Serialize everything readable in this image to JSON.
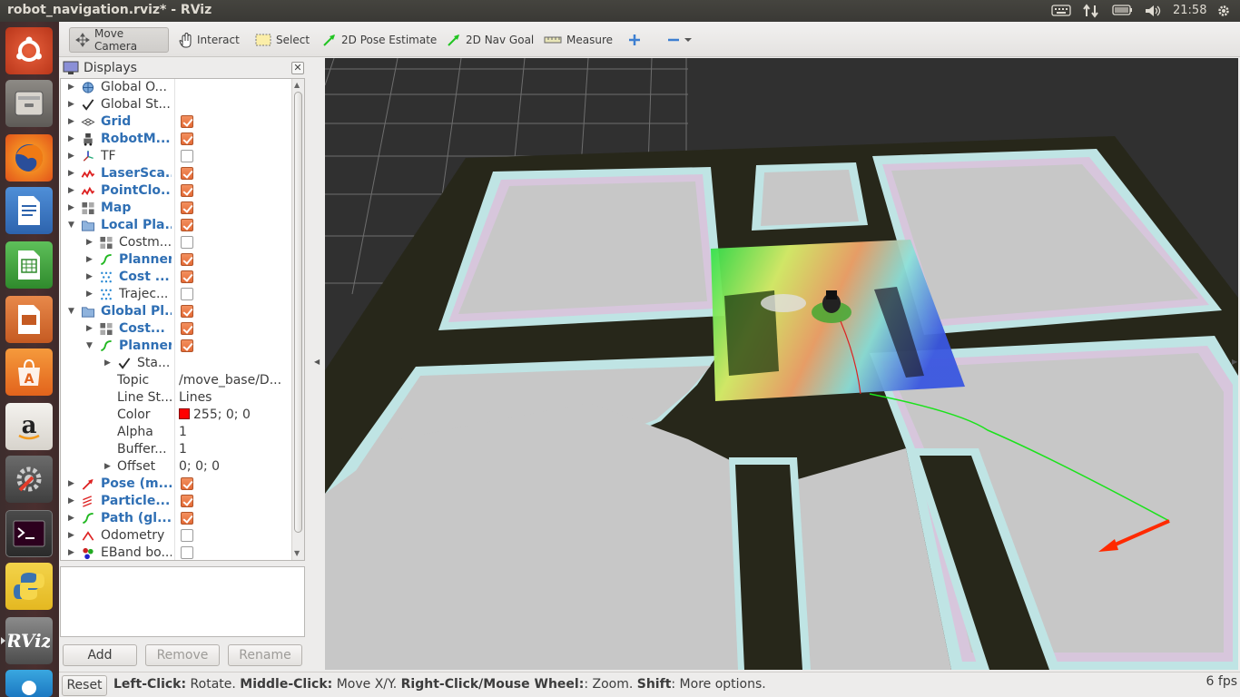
{
  "window": {
    "title": "robot_navigation.rviz* - RViz"
  },
  "tray": {
    "clock": "21:58"
  },
  "toolbar": {
    "move_camera": "Move Camera",
    "interact": "Interact",
    "select": "Select",
    "pose_estimate": "2D Pose Estimate",
    "nav_goal": "2D Nav Goal",
    "measure": "Measure"
  },
  "displays": {
    "title": "Displays",
    "rows": [
      {
        "label": "Global O...",
        "blue": false,
        "checked": null
      },
      {
        "label": "Global St...",
        "blue": false,
        "checked": null
      },
      {
        "label": "Grid",
        "blue": true,
        "checked": true
      },
      {
        "label": "RobotM...",
        "blue": true,
        "checked": true
      },
      {
        "label": "TF",
        "blue": false,
        "checked": false
      },
      {
        "label": "LaserSca...",
        "blue": true,
        "checked": true
      },
      {
        "label": "PointClo...",
        "blue": true,
        "checked": true
      },
      {
        "label": "Map",
        "blue": true,
        "checked": true
      },
      {
        "label": "Local Pla...",
        "blue": true,
        "checked": true
      },
      {
        "label": "Costm...",
        "blue": false,
        "checked": false
      },
      {
        "label": "Planner",
        "blue": true,
        "checked": true
      },
      {
        "label": "Cost ...",
        "blue": true,
        "checked": true
      },
      {
        "label": "Trajec...",
        "blue": false,
        "checked": false
      },
      {
        "label": "Global Pl...",
        "blue": true,
        "checked": true
      },
      {
        "label": "Cost...",
        "blue": true,
        "checked": true
      },
      {
        "label": "Planner",
        "blue": true,
        "checked": true
      },
      {
        "label": "Sta...",
        "blue": false,
        "checked": null
      },
      {
        "label": "Topic",
        "blue": false,
        "value": "/move_base/D..."
      },
      {
        "label": "Line St...",
        "blue": false,
        "value": "Lines"
      },
      {
        "label": "Color",
        "blue": false,
        "value": "255; 0; 0"
      },
      {
        "label": "Alpha",
        "blue": false,
        "value": "1"
      },
      {
        "label": "Buffer...",
        "blue": false,
        "value": "1"
      },
      {
        "label": "Offset",
        "blue": false,
        "value": "0; 0; 0"
      },
      {
        "label": "Pose (m...",
        "blue": true,
        "checked": true
      },
      {
        "label": "Particle...",
        "blue": true,
        "checked": true
      },
      {
        "label": "Path (gl...",
        "blue": true,
        "checked": true
      },
      {
        "label": "Odometry",
        "blue": false,
        "checked": false
      },
      {
        "label": "EBand bo...",
        "blue": false,
        "checked": false
      }
    ],
    "buttons": {
      "add": "Add",
      "remove": "Remove",
      "rename": "Rename"
    }
  },
  "status": {
    "reset": "Reset",
    "k1": "Left-Click:",
    "v1": " Rotate. ",
    "k2": "Middle-Click:",
    "v2": " Move X/Y. ",
    "k3": "Right-Click/Mouse Wheel:",
    "v3": ": Zoom. ",
    "k4": "Shift",
    "v4": ": More options.",
    "fps": "6 fps"
  },
  "colors": {
    "accent_check": "#e46a36",
    "label_blue": "#2f6fb4",
    "path": "#00e000",
    "goal_arrow": "#ff2a00"
  }
}
